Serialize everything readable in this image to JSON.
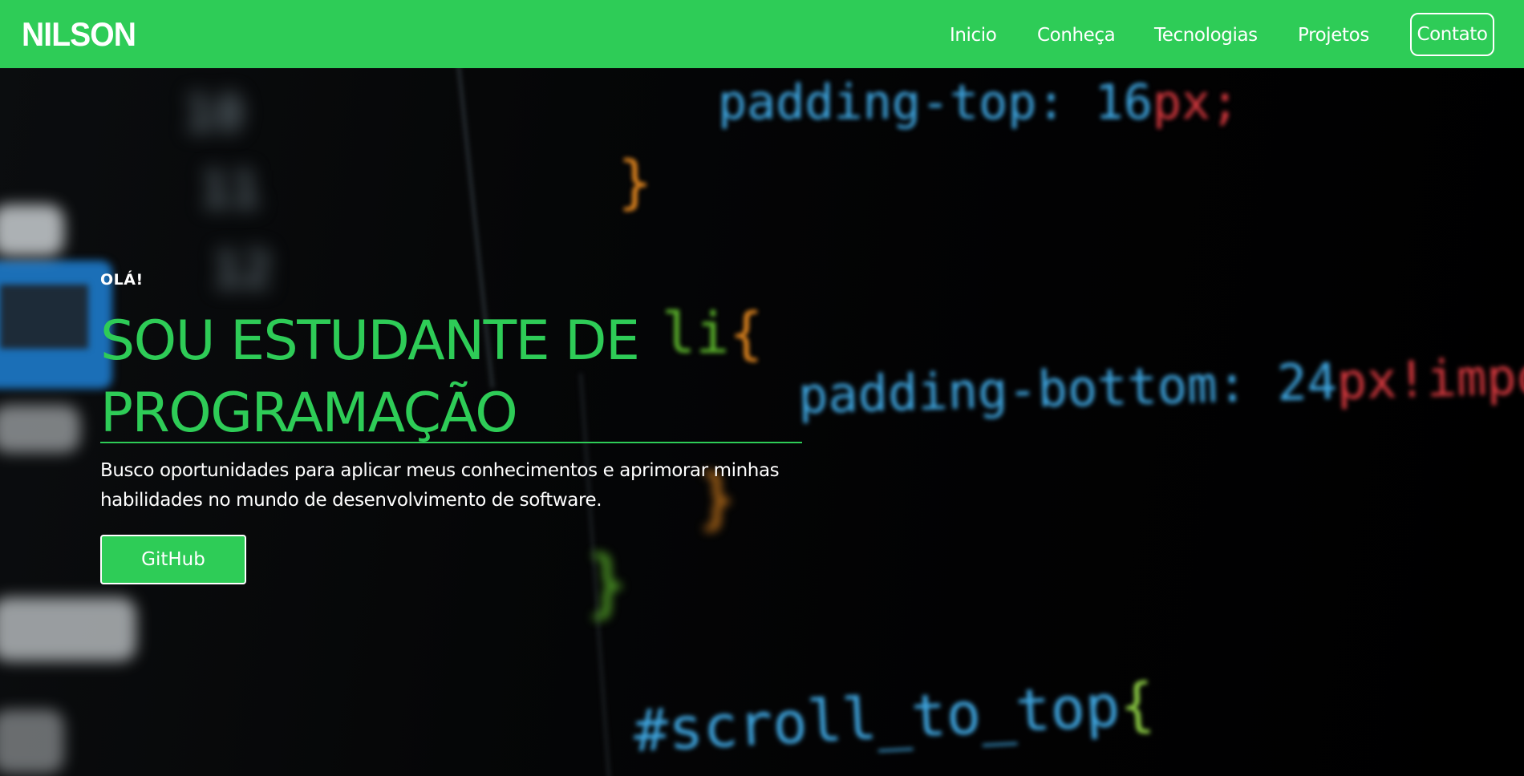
{
  "navbar": {
    "brand": "NILSON",
    "links": [
      {
        "label": "Inicio"
      },
      {
        "label": "Conheça"
      },
      {
        "label": "Tecnologias"
      },
      {
        "label": "Projetos"
      }
    ],
    "contact_label": "Contato",
    "background_color": "#2ecc57"
  },
  "hero": {
    "greeting": "OLÁ!",
    "headline_line1": "SOU ESTUDANTE DE",
    "headline_line2": "PROGRAMAÇÃO",
    "subtitle": "Busco oportunidades para aplicar meus conhecimentos e aprimorar minhas habilidades no mundo de desenvolvimento de software.",
    "button_label": "GitHub",
    "accent_color": "#2ecc57"
  },
  "background_code": {
    "line_numbers": [
      "10",
      "11",
      "12"
    ],
    "padding_top_prop": "padding-top:",
    "padding_top_num": "16",
    "padding_top_unit": "px;",
    "brace_1": "}",
    "li_selector": "li",
    "li_brace": "{",
    "padding_bottom_prop": "padding-bottom:",
    "padding_bottom_num": "24",
    "padding_bottom_unit": "px!importa",
    "brace_2": "}",
    "brace_3": "}",
    "scroll_selector": "#scroll_to_top",
    "scroll_brace": "{"
  }
}
